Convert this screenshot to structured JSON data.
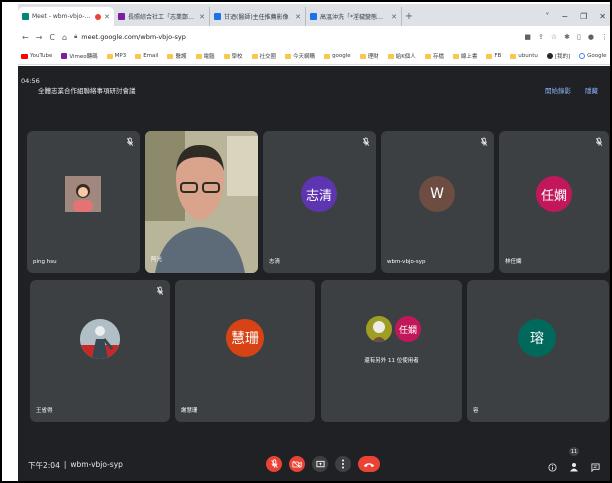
{
  "browser": {
    "tabs": [
      {
        "title": "Meet - wbm-vbjo-syp",
        "favicon_color": "#00897b",
        "recording": true,
        "active": true
      },
      {
        "title": "長照綜合社工「志業鄭重行卡(2)」",
        "favicon_color": "#7b1fa2",
        "active": false
      },
      {
        "title": "甘迺(醫師)主任推薦影像",
        "favicon_color": "#1a73e8",
        "active": false
      },
      {
        "title": "高溫沖洗「*淫穢變態行為」",
        "favicon_color": "#1a73e8",
        "active": false
      }
    ],
    "new_tab": "+",
    "window_controls": [
      "˅",
      "−",
      "❐",
      "✕"
    ],
    "url": "meet.google.com/wbm-vbjo-syp",
    "bookmarks": [
      {
        "label": "YouTube",
        "icon": "youtube-icon"
      },
      {
        "label": "Vimeo轉碼",
        "icon": "vimeo-icon"
      },
      {
        "label": "MP3",
        "icon": "folder-icon"
      },
      {
        "label": "Email",
        "icon": "folder-icon"
      },
      {
        "label": "醫護",
        "icon": "folder-icon"
      },
      {
        "label": "電腦",
        "icon": "folder-icon"
      },
      {
        "label": "學校",
        "icon": "folder-icon"
      },
      {
        "label": "社交圈",
        "icon": "folder-icon"
      },
      {
        "label": "今天網購",
        "icon": "folder-icon"
      },
      {
        "label": "google",
        "icon": "folder-icon"
      },
      {
        "label": "理財",
        "icon": "folder-icon"
      },
      {
        "label": "給K個人",
        "icon": "folder-icon"
      },
      {
        "label": "存檔",
        "icon": "folder-icon"
      },
      {
        "label": "線上書",
        "icon": "folder-icon"
      },
      {
        "label": "FB",
        "icon": "folder-icon"
      },
      {
        "label": "ubuntu",
        "icon": "folder-icon"
      },
      {
        "label": "[我的]",
        "icon": "github-icon"
      },
      {
        "label": "Google",
        "icon": "google-icon"
      },
      {
        "label": "其他書籤",
        "icon": "folder-icon"
      }
    ]
  },
  "meet": {
    "elapsed": "04:56",
    "title": "全體志業合作組聯絡事項研討會議",
    "top_buttons": [
      "開始錄影",
      "隱藏"
    ],
    "participants": [
      {
        "name": "ping hsu",
        "type": "photo",
        "muted": true
      },
      {
        "name": "阿光",
        "type": "video",
        "muted": false
      },
      {
        "name": "志清",
        "type": "initials",
        "initials": "志清",
        "color": "#5e35b1",
        "muted": true
      },
      {
        "name": "wbm-vbjo-syp",
        "type": "initials",
        "initials": "W",
        "color": "#6d4c41",
        "muted": true
      },
      {
        "name": "林任嫻",
        "type": "initials",
        "initials": "任嫻",
        "color": "#c2185b",
        "muted": true
      },
      {
        "name": "王省得",
        "type": "photo",
        "muted": true
      },
      {
        "name": "謝慧珊",
        "type": "initials",
        "initials": "慧珊",
        "color": "#d84315",
        "muted": false
      },
      {
        "name": "還有另外 11 位使用者",
        "type": "group",
        "initials": "任嫻",
        "color": "#c2185b",
        "muted": false
      },
      {
        "name": "容",
        "type": "initials",
        "initials": "瑢",
        "color": "#00695c",
        "muted": false
      }
    ],
    "clock": "下午2:04",
    "meeting_code": "wbm-vbjo-syp",
    "participant_count": "11",
    "colors": {
      "background": "#202124",
      "tile": "#3c4043",
      "danger": "#ea4335",
      "link": "#8ab4f8"
    }
  }
}
